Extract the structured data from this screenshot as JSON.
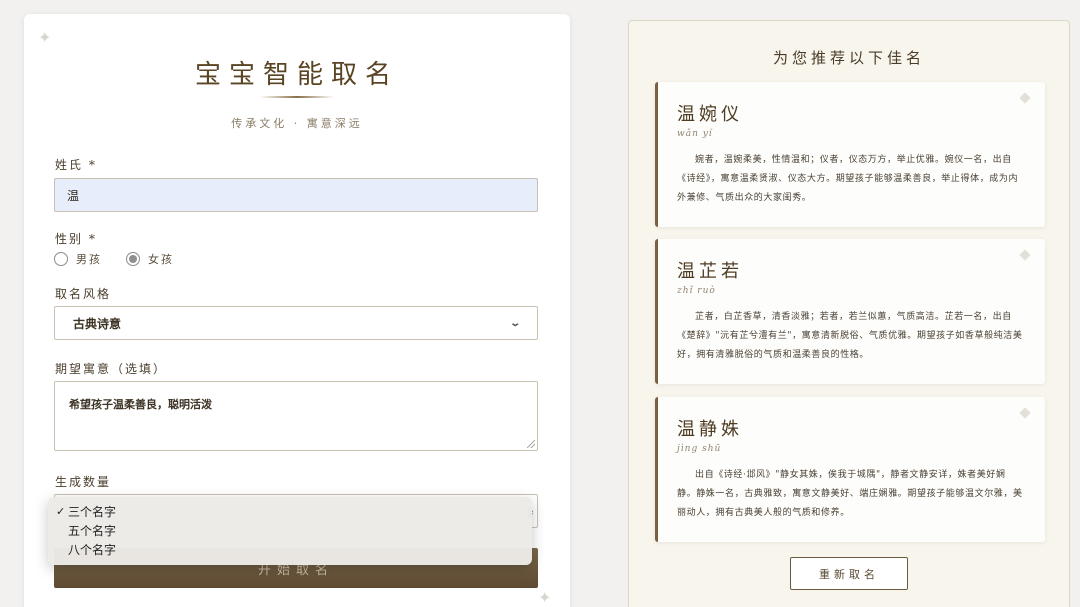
{
  "form": {
    "title": "宝宝智能取名",
    "subtitle": "传承文化 · 寓意深远",
    "surname": {
      "label": "姓氏 *",
      "value": "温"
    },
    "gender": {
      "label": "性别 *",
      "options": [
        {
          "label": "男孩",
          "checked": false
        },
        {
          "label": "女孩",
          "checked": true
        }
      ]
    },
    "style": {
      "label": "取名风格",
      "value": "古典诗意"
    },
    "meaning": {
      "label": "期望寓意（选填）",
      "value": "希望孩子温柔善良，聪明活泼"
    },
    "count": {
      "label": "生成数量",
      "options": [
        "三个名字",
        "五个名字",
        "八个名字"
      ],
      "selected_index": 0,
      "check_mark": "✓"
    },
    "submit_label": "开始取名"
  },
  "results": {
    "title": "为您推荐以下佳名",
    "names": [
      {
        "name": "温婉仪",
        "pinyin": "wǎn yí",
        "description": "婉者，温婉柔美，性情温和；仪者，仪态万方，举止优雅。婉仪一名，出自《诗经》，寓意温柔贤淑、仪态大方。期望孩子能够温柔善良，举止得体，成为内外兼修、气质出众的大家闺秀。"
      },
      {
        "name": "温芷若",
        "pinyin": "zhǐ ruò",
        "description": "芷者，白芷香草，清香淡雅；若者，若兰似蕙，气质高洁。芷若一名，出自《楚辞》\"沅有芷兮澧有兰\"，寓意清新脱俗、气质优雅。期望孩子如香草般纯洁美好，拥有清雅脱俗的气质和温柔善良的性格。"
      },
      {
        "name": "温静姝",
        "pinyin": "jìng shū",
        "description": "出自《诗经·邶风》\"静女其姝，俟我于城隅\"，静者文静安详，姝者美好娴静。静姝一名，古典雅致，寓意文静美好、端庄娴雅。期望孩子能够温文尔雅，美丽动人，拥有古典美人般的气质和修养。"
      }
    ],
    "rename_label": "重新取名"
  },
  "icons": {
    "sparkle": "✦",
    "diamond": "diamond-icon",
    "chevron": "chevron-down-icon"
  },
  "colors": {
    "brand_brown": "#5e4a30",
    "accent_border": "#7a6040",
    "panel_bg": "#f7f5ec",
    "input_autofill_bg": "#e8edfc"
  }
}
